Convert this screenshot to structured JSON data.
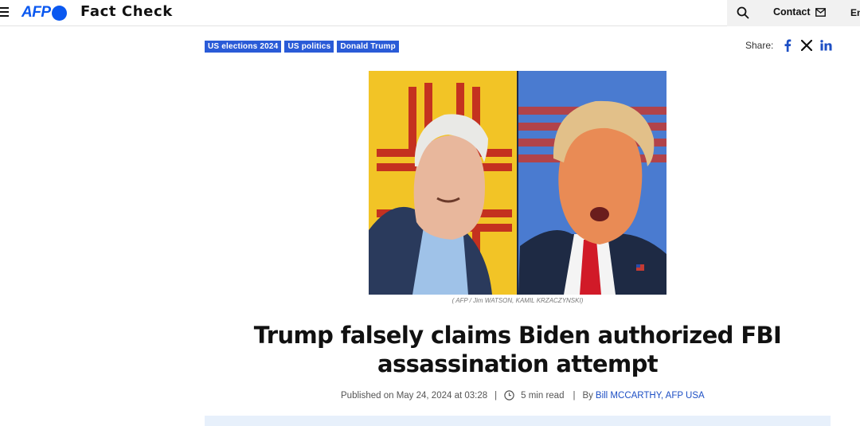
{
  "header": {
    "logo_text": "AFP",
    "site_title": "Fact Check",
    "contact_label": "Contact",
    "language_label": "En"
  },
  "tags": [
    "US elections 2024",
    "US politics",
    "Donald Trump"
  ],
  "share": {
    "label": "Share:",
    "icons": [
      "facebook-icon",
      "x-icon",
      "linkedin-icon"
    ]
  },
  "hero": {
    "caption": "( AFP / Jim WATSON, KAMIL KRZACZYNSKI)"
  },
  "article": {
    "title": "Trump falsely claims Biden authorized FBI assassination attempt",
    "published": "Published on May 24, 2024 at 03:28",
    "read_time": "5 min read",
    "by_prefix": "By",
    "author": "Bill MCCARTHY, AFP USA"
  },
  "colors": {
    "brand_blue": "#0a58f0",
    "tag_blue": "#2a5bd7",
    "link_blue": "#1d4fc4",
    "summary_bg": "#e7f0fb"
  }
}
